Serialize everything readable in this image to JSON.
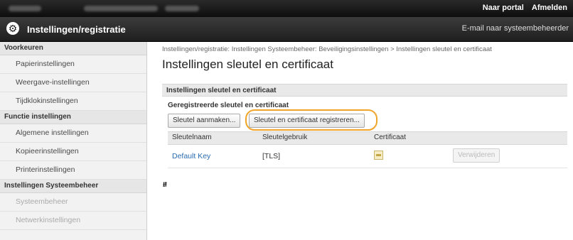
{
  "topbar": {
    "portal_link": "Naar portal",
    "logout_link": "Afmelden"
  },
  "header": {
    "title": "Instellingen/registratie",
    "mail_link": "E-mail naar systeembeheerder"
  },
  "sidebar": {
    "sections": [
      {
        "label": "Voorkeuren",
        "items": [
          "Papierinstellingen",
          "Weergave-instellingen",
          "Tijdklokinstellingen"
        ]
      },
      {
        "label": "Functie instellingen",
        "items": [
          "Algemene instellingen",
          "Kopieerinstellingen",
          "Printerinstellingen"
        ]
      },
      {
        "label": "Instellingen Systeembeheer",
        "items": [
          "Systeembeheer",
          "Netwerkinstellingen"
        ]
      }
    ]
  },
  "main": {
    "breadcrumb": "Instellingen/registratie: Instellingen Systeembeheer: Beveiligingsinstellingen > Instellingen sleutel en certificaat",
    "page_title": "Instellingen sleutel en certificaat",
    "section_title": "Instellingen sleutel en certificaat",
    "subsection_title": "Geregistreerde sleutel en certificaat",
    "buttons": {
      "generate": "Sleutel aanmaken...",
      "register": "Sleutel en certificaat registreren..."
    },
    "table": {
      "headers": [
        "Sleutelnaam",
        "Sleutelgebruik",
        "Certificaat"
      ],
      "rows": [
        {
          "key_name": "Default Key",
          "usage": "[TLS]",
          "delete": "Verwijderen"
        }
      ]
    }
  }
}
